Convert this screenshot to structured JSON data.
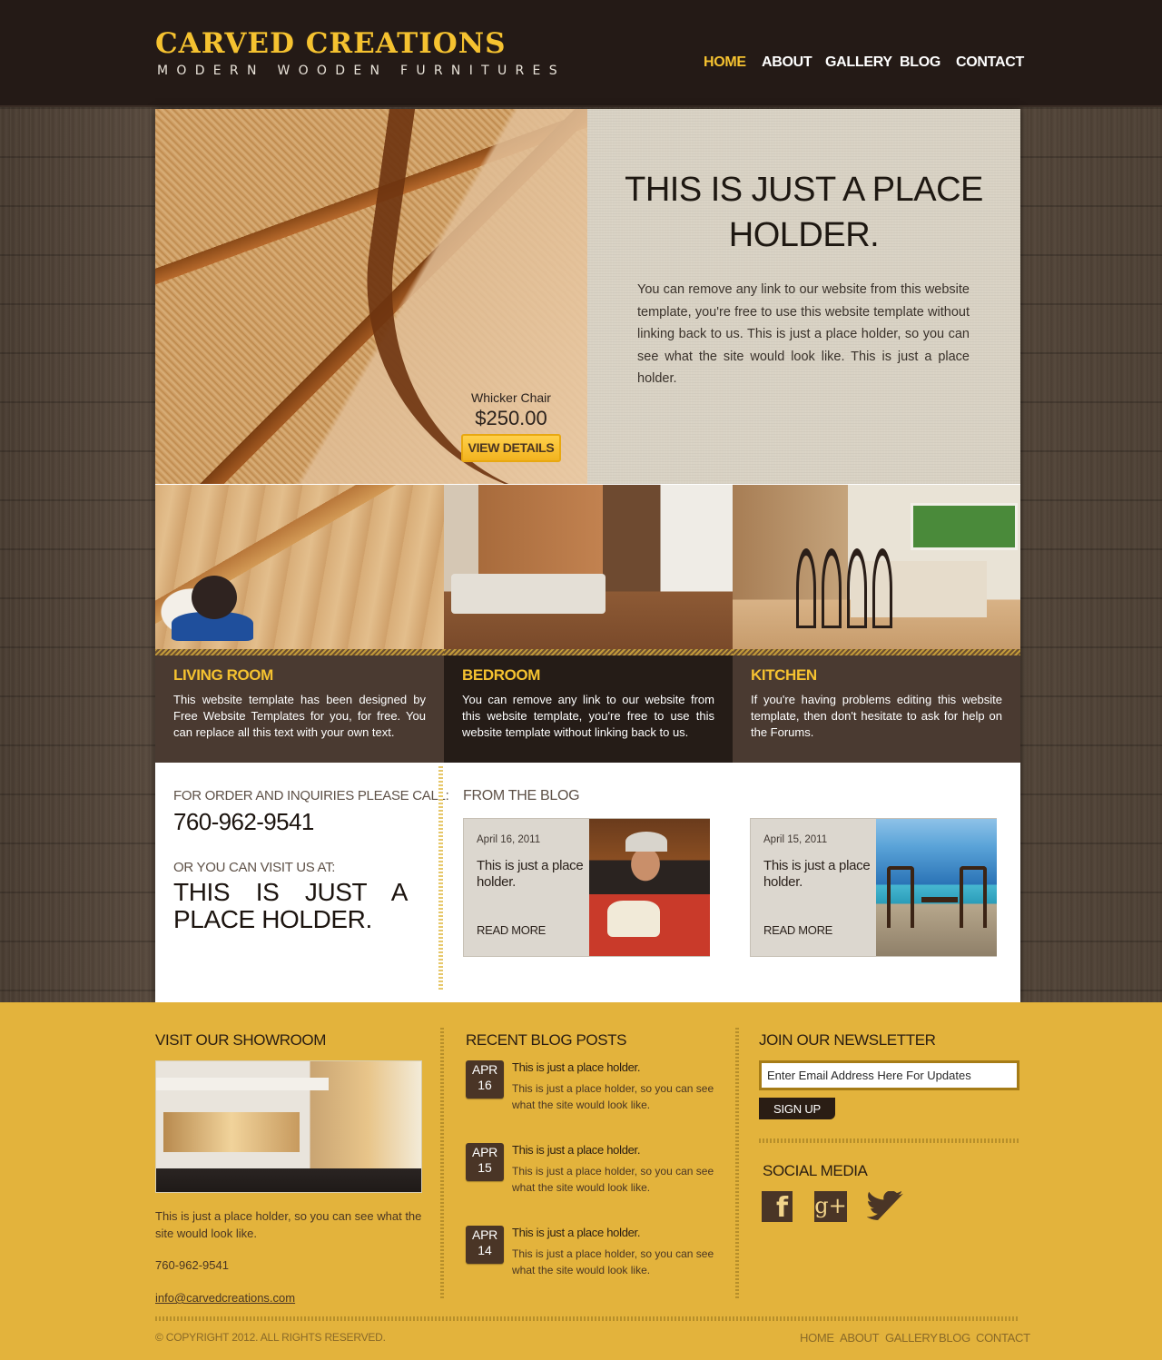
{
  "header": {
    "logo_title": "CARVED CREATIONS",
    "logo_subtitle": "MODERN WOODEN FURNITURES",
    "nav": [
      "HOME",
      "ABOUT",
      "GALLERY",
      "BLOG",
      "CONTACT"
    ],
    "active_nav": "HOME"
  },
  "hero": {
    "product_name": "Whicker Chair",
    "product_price": "$250.00",
    "button_label": "VIEW DETAILS",
    "title": "THIS IS JUST A PLACE HOLDER.",
    "paragraph": "You can remove any link to our website from this website template, you're free to use this website template without linking back to us. This is just a place holder, so you can see what the site would look like. This is just a place holder."
  },
  "rooms": [
    {
      "title": "LIVING ROOM",
      "text": "This website template has been designed by Free Website Templates for you, for free. You can replace all this text with your own text."
    },
    {
      "title": "BEDROOM",
      "text": "You can remove any link to our website from this website template, you're free to use this website template without linking back to us."
    },
    {
      "title": "KITCHEN",
      "text": "If you're having problems editing this website template, then don't hesitate to ask for help on the Forums."
    }
  ],
  "contact": {
    "order_label": "FOR ORDER AND INQUIRIES PLEASE CALL:",
    "phone": "760-962-9541",
    "visit_label": "OR YOU CAN VISIT US AT:",
    "visit_text": "THIS IS JUST A PLACE HOLDER."
  },
  "blog": {
    "heading": "FROM THE BLOG",
    "posts": [
      {
        "date": "April 16, 2011",
        "title": "This is just a place holder.",
        "link": "READ MORE"
      },
      {
        "date": "April 15, 2011",
        "title": "This is just a place holder.",
        "link": "READ MORE"
      }
    ]
  },
  "footer": {
    "showroom_heading": "VISIT OUR SHOWROOM",
    "showroom_text": "This is just a place holder, so you can see what the site would look like.",
    "showroom_phone": "760-962-9541",
    "showroom_email": "info@carvedcreations.com",
    "recent_heading": "RECENT BLOG POSTS",
    "recent_posts": [
      {
        "month": "APR",
        "day": "16",
        "title": "This is just a place holder.",
        "text": "This is just a place holder, so you can see what the site would look like."
      },
      {
        "month": "APR",
        "day": "15",
        "title": "This is just a place holder.",
        "text": "This is just a place holder, so you can see what the site would look like."
      },
      {
        "month": "APR",
        "day": "14",
        "title": "This is just a place holder.",
        "text": "This is just a place holder, so you can see what the site would look like."
      }
    ],
    "newsletter_heading": "JOIN OUR NEWSLETTER",
    "newsletter_placeholder": "Enter Email Address Here For Updates",
    "signup_label": "SIGN UP",
    "social_heading": "SOCIAL MEDIA",
    "social_icons": [
      "facebook-icon",
      "google-plus-icon",
      "twitter-icon"
    ],
    "copyright": "© COPYRIGHT 2012. ALL RIGHTS RESERVED.",
    "nav": [
      "HOME",
      "ABOUT",
      "GALLERY",
      "BLOG",
      "CONTACT"
    ]
  },
  "colors": {
    "header_bg": "#241a16",
    "accent_yellow": "#f5c230",
    "footer_bg": "#e3b33c",
    "room_panel": "#4a3a31",
    "room_panel_dark": "#251c17"
  }
}
